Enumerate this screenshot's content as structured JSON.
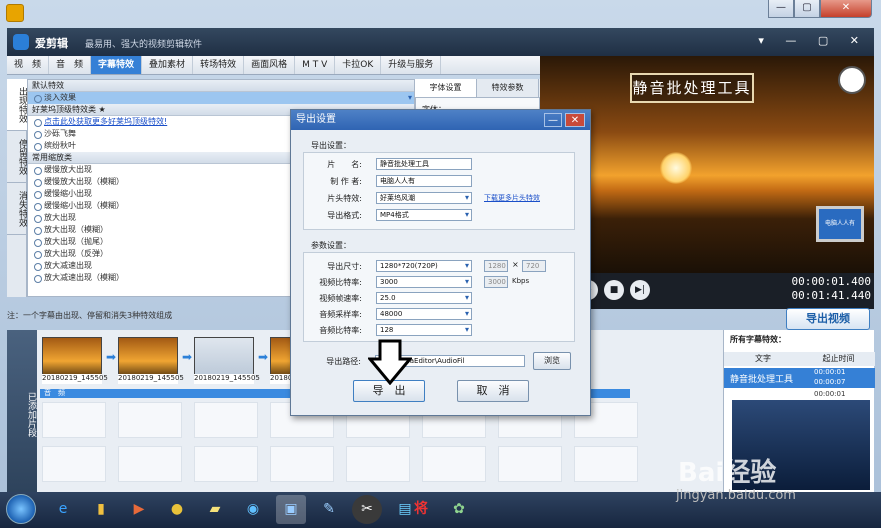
{
  "window": {
    "controls": [
      "—",
      "▢",
      "✕"
    ]
  },
  "app": {
    "name": "爱剪辑",
    "slogan": "最易用、强大的视频剪辑软件",
    "header_controls": "▾ — ▢ ✕"
  },
  "menu": [
    "视　频",
    "音　频",
    "字幕特效",
    "叠加素材",
    "转场特效",
    "画面风格",
    "M T V",
    "卡拉OK",
    "升级与服务"
  ],
  "left_tabs": [
    "出现特效",
    "停留特效",
    "消失特效"
  ],
  "effects": {
    "sections": [
      {
        "title": "默认特效",
        "items": [
          {
            "label": "淡入效果",
            "selected": true
          }
        ]
      },
      {
        "title": "好莱坞顶级特效类 ★",
        "items": [
          {
            "label": "点击此处获取更多好莱坞顶级特效!",
            "link": true
          },
          {
            "label": "沙砾飞舞"
          },
          {
            "label": "缤纷秋叶"
          }
        ]
      },
      {
        "title": "常用缩放类",
        "items": [
          {
            "label": "缓慢放大出现"
          },
          {
            "label": "缓慢放大出现（模糊）"
          },
          {
            "label": "缓慢缩小出现"
          },
          {
            "label": "缓慢缩小出现（模糊）"
          },
          {
            "label": "放大出现"
          },
          {
            "label": "放大出现（模糊）"
          },
          {
            "label": "放大出现（抛尾）"
          },
          {
            "label": "放大出现（反弹）"
          },
          {
            "label": "放大减速出现"
          },
          {
            "label": "放大减速出现（模糊）"
          }
        ]
      }
    ]
  },
  "tip": "注：一个字幕由出现、停留和消失3种特效组成",
  "prop_tabs": [
    "字体设置",
    "特效参数"
  ],
  "prop_label": "字体：",
  "preview": {
    "title_text": "静音批处理工具",
    "monitor_text": "电脑人人有",
    "time_current": "00:00:01.400",
    "time_total": "00:01:41.440"
  },
  "export_button": "导出视频",
  "timeline": {
    "side_label": "已添加片段",
    "clips": [
      "20180219_145505",
      "20180219_145505",
      "20180219_145505",
      "20180219_145505"
    ],
    "audio_label": "音　频"
  },
  "subtitles": {
    "header": "所有字幕特效：",
    "col_text": "文字",
    "col_time": "起止时间",
    "row_text": "静音批处理工具",
    "row_time_start": "00:00:01",
    "row_time_end": "00:00:07",
    "row2_time_start": "00:00:01",
    "row2_time_end": "00:00:07"
  },
  "dialog": {
    "title": "导出设置",
    "minimize": "—",
    "close": "✕",
    "export_group": "导出设置：",
    "name_label": "片　　名:",
    "name_value": "静音批处理工具",
    "author_label": "制 作 者:",
    "author_value": "电脑人人有",
    "intro_label": "片头特效:",
    "intro_value": "好莱坞风潮",
    "download_link": "下载更多片头特效",
    "format_label": "导出格式:",
    "format_value": "MP4格式",
    "params_group": "参数设置：",
    "size_label": "导出尺寸:",
    "size_value": "1280*720(720P)",
    "width_value": "1280",
    "times": "×",
    "height_value": "720",
    "vbitrate_label": "视频比特率:",
    "vbitrate_value": "3000",
    "vbitrate_box": "3000",
    "kbps": "Kbps",
    "fps_label": "视频帧速率:",
    "fps_value": "25.0",
    "asample_label": "音频采样率:",
    "asample_value": "48000",
    "abitrate_label": "音频比特率:",
    "abitrate_value": "128",
    "path_label": "导出路径:",
    "path_value": "86)\\MediaEditor\\AudioFil",
    "browse": "浏览",
    "export_btn": "导　出",
    "cancel_btn": "取　消"
  },
  "watermark": {
    "text": "Bai经验",
    "url": "jingyan.baidu.com"
  }
}
